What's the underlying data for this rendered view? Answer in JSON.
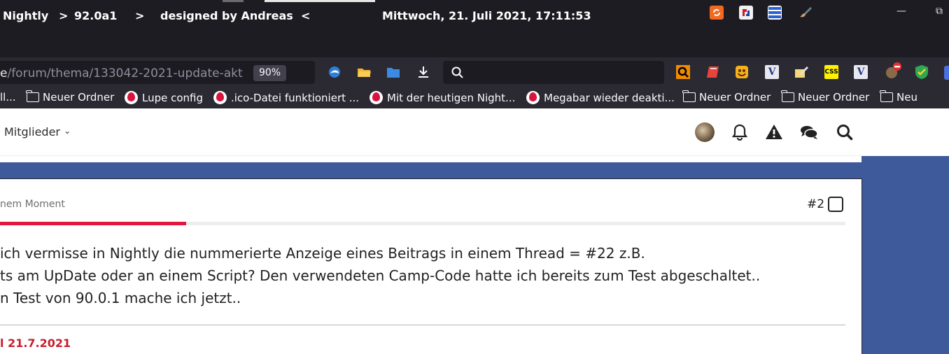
{
  "titlebar": {
    "title_app": "Nightly",
    "title_sep1": ">",
    "title_version": "92.0a1",
    "title_sep2": ">",
    "title_designer": "designed by Andreas",
    "title_sep3": "<",
    "clock": "Mittwoch, 21. Juli 2021, 17:11:53",
    "minimize_glyph": "—",
    "restore_glyph": "⧉"
  },
  "navbar": {
    "url_prefix": "e",
    "url_path": "/forum/thema/133042-2021-update-akt",
    "zoom": "90%",
    "search_placeholder": ""
  },
  "extensions": [
    {
      "icon": "quicknote-icon",
      "label": "",
      "bg": "#f08a00",
      "fg": "#000"
    },
    {
      "icon": "bookmark-red-icon",
      "label": "",
      "bg": "#e7443c",
      "fg": "#fff"
    },
    {
      "icon": "emoji-icon",
      "label": "",
      "bg": "#f3b11d",
      "fg": "#6b2b00"
    },
    {
      "icon": "v-icon",
      "label": "V",
      "bg": "#e8e8f0",
      "fg": "#2b3a87"
    },
    {
      "icon": "note-pen-icon",
      "label": "",
      "bg": "#f5d77b",
      "fg": "#333"
    },
    {
      "icon": "css-icon",
      "label": "CSS",
      "bg": "#fff200",
      "fg": "#000"
    },
    {
      "icon": "v-icon",
      "label": "V",
      "bg": "#e8e8f0",
      "fg": "#2b3a87"
    },
    {
      "icon": "ublock-avatar-icon",
      "label": "",
      "bg": "#8a6a4b",
      "fg": "#fff"
    },
    {
      "icon": "shield-check-icon",
      "label": "",
      "bg": "#2fa84f",
      "fg": "#fff"
    }
  ],
  "bookmarks": [
    {
      "type": "text",
      "label": "ll..."
    },
    {
      "type": "folder",
      "label": "Neuer Ordner"
    },
    {
      "type": "flame",
      "label": "Lupe config"
    },
    {
      "type": "flame",
      "label": ".ico-Datei funktioniert ..."
    },
    {
      "type": "flame",
      "label": "Mit der heutigen Night..."
    },
    {
      "type": "flame",
      "label": "Megabar wieder deakti..."
    },
    {
      "type": "folder",
      "label": "Neuer Ordner"
    },
    {
      "type": "folder",
      "label": "Neuer Ordner"
    },
    {
      "type": "folder",
      "label": "Neu"
    }
  ],
  "forum": {
    "menu_members": "Mitglieder",
    "menu_chevron": "⌄",
    "post": {
      "time_meta": "nem Moment",
      "number": "#2",
      "read_progress": 0.22,
      "lines": [
        "ich vermisse in Nightly die nummerierte Anzeige eines Beitrags in einem Thread = #22 z.B.",
        "ts am UpDate oder an einem Script? Den verwendeten Camp-Code hatte ich bereits zum Test abgeschaltet..",
        "n Test von 90.0.1 mache ich jetzt.."
      ],
      "edit_date": "l 21.7.2021"
    }
  },
  "colors": {
    "accent_red": "#e3173e",
    "forum_blue": "#3f5a9b",
    "date_red": "#c91d2a"
  }
}
